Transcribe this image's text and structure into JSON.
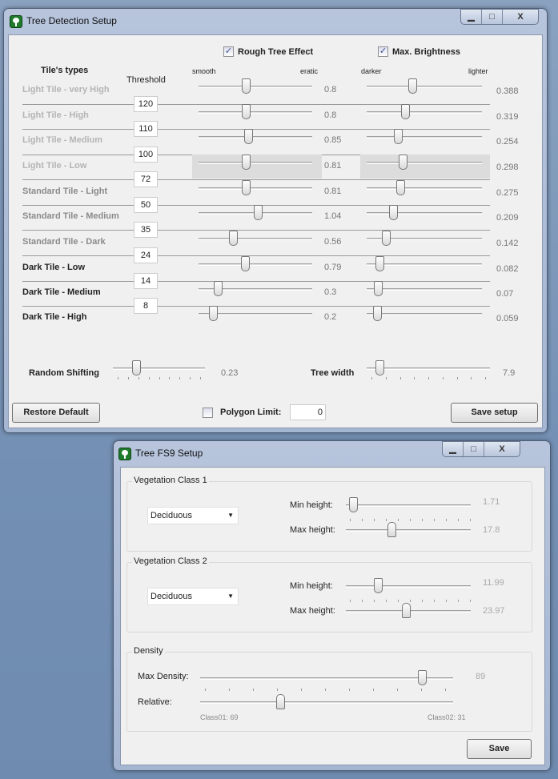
{
  "window1": {
    "title": "Tree Detection Setup",
    "controls": {
      "minimize": "▁",
      "maximize": "□",
      "close": "X"
    },
    "rough_tree_effect": {
      "label": "Rough Tree Effect",
      "checked": true
    },
    "max_brightness": {
      "label": "Max. Brightness",
      "checked": true
    },
    "headers": {
      "tile_types": "Tile's types",
      "threshold": "Threshold",
      "smooth": "smooth",
      "eratic": "eratic",
      "darker": "darker",
      "lighter": "lighter"
    },
    "rows": [
      {
        "label": "Light Tile - very High",
        "rough": "0.8",
        "brightness": "0.388"
      },
      {
        "label": "Light Tile - High",
        "rough": "0.8",
        "brightness": "0.319"
      },
      {
        "label": "Light Tile - Medium",
        "rough": "0.85",
        "brightness": "0.254"
      },
      {
        "label": "Light Tile - Low",
        "rough": "0.81",
        "brightness": "0.298"
      },
      {
        "label": "Standard Tile - Light",
        "rough": "0.81",
        "brightness": "0.275"
      },
      {
        "label": "Standard Tile - Medium",
        "rough": "1.04",
        "brightness": "0.209"
      },
      {
        "label": "Standard Tile - Dark",
        "rough": "0.56",
        "brightness": "0.142"
      },
      {
        "label": "Dark Tile - Low",
        "rough": "0.79",
        "brightness": "0.082"
      },
      {
        "label": "Dark Tile - Medium",
        "rough": "0.3",
        "brightness": "0.07"
      },
      {
        "label": "Dark Tile - High",
        "rough": "0.2",
        "brightness": "0.059"
      }
    ],
    "thresholds": [
      "120",
      "110",
      "100",
      "72",
      "50",
      "35",
      "24",
      "14",
      "8"
    ],
    "random_shifting": {
      "label": "Random Shifting",
      "value": "0.23"
    },
    "tree_width": {
      "label": "Tree width",
      "value": "7.9"
    },
    "restore_default": "Restore Default",
    "polygon_limit": {
      "label": "Polygon Limit:",
      "checked": false,
      "value": "0"
    },
    "save_setup": "Save setup"
  },
  "window2": {
    "title": "Tree FS9 Setup",
    "controls": {
      "minimize": "▁",
      "maximize": "□",
      "close": "X"
    },
    "class1": {
      "label": "Vegetation Class 1",
      "type": "Deciduous",
      "min_label": "Min height:",
      "min": "1.71",
      "max_label": "Max height:",
      "max": "17.8"
    },
    "class2": {
      "label": "Vegetation Class 2",
      "type": "Deciduous",
      "min_label": "Min height:",
      "min": "11.99",
      "max_label": "Max height:",
      "max": "23.97"
    },
    "density": {
      "label": "Density",
      "max_label": "Max Density:",
      "max": "89",
      "relative_label": "Relative:",
      "class01": "Class01: 69",
      "class02": "Class02: 31"
    },
    "save": "Save"
  },
  "colors": {
    "check": "#3a4f8f",
    "client": "#f0f0f0",
    "icon": "#1f7a2a"
  }
}
